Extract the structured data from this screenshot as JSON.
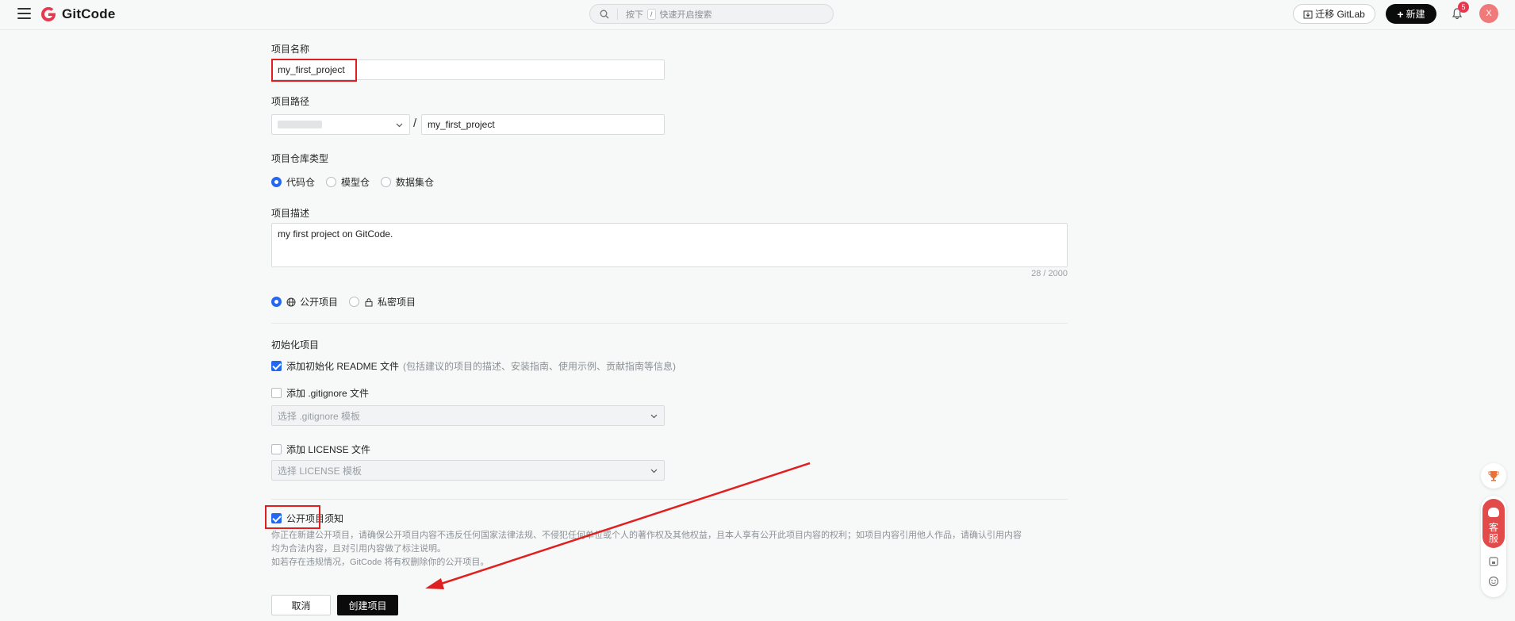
{
  "header": {
    "logo_text": "GitCode",
    "search_prefix": "按下",
    "search_key": "/",
    "search_suffix": "快速开启搜索",
    "migrate_label": "迁移 GitLab",
    "new_label": "新建",
    "notification_count": "5",
    "avatar_initial": "X"
  },
  "form": {
    "name_label": "项目名称",
    "name_value": "my_first_project",
    "path_label": "项目路径",
    "path_separator": "/",
    "path_value": "my_first_project",
    "repo_type_label": "项目仓库类型",
    "repo_types": [
      {
        "label": "代码仓",
        "selected": true
      },
      {
        "label": "模型仓",
        "selected": false
      },
      {
        "label": "数据集仓",
        "selected": false
      }
    ],
    "desc_label": "项目描述",
    "desc_value": "my first project on GitCode.",
    "desc_counter": "28 / 2000",
    "visibility": [
      {
        "label": "公开项目",
        "selected": true,
        "icon": "globe-icon"
      },
      {
        "label": "私密项目",
        "selected": false,
        "icon": "lock-icon"
      }
    ],
    "init_label": "初始化项目",
    "readme_label": "添加初始化 README 文件",
    "readme_hint": "(包括建议的项目的描述、安装指南、使用示例、贡献指南等信息)",
    "readme_checked": true,
    "gitignore_label": "添加 .gitignore 文件",
    "gitignore_checked": false,
    "gitignore_placeholder": "选择 .gitignore 模板",
    "license_label": "添加 LICENSE 文件",
    "license_checked": false,
    "license_placeholder": "选择 LICENSE 模板",
    "notice_label": "公开项目须知",
    "notice_checked": true,
    "notice_text_1": "你正在新建公开项目，请确保公开项目内容不违反任何国家法律法规、不侵犯任何单位或个人的著作权及其他权益，且本人享有公开此项目内容的权利；如项目内容引用他人作品，请确认引用内容",
    "notice_text_2": "均为合法内容，且对引用内容做了标注说明。",
    "notice_text_3": "如若存在违规情况，GitCode 将有权删除你的公开项目。",
    "cancel_label": "取消",
    "create_label": "创建项目"
  },
  "widgets": {
    "kefu_line1": "客",
    "kefu_line2": "服"
  },
  "colors": {
    "accent": "#2468f2",
    "brand_red": "#e8384f",
    "annotation_red": "#e02020",
    "primary_button": "#0b0b0b"
  }
}
